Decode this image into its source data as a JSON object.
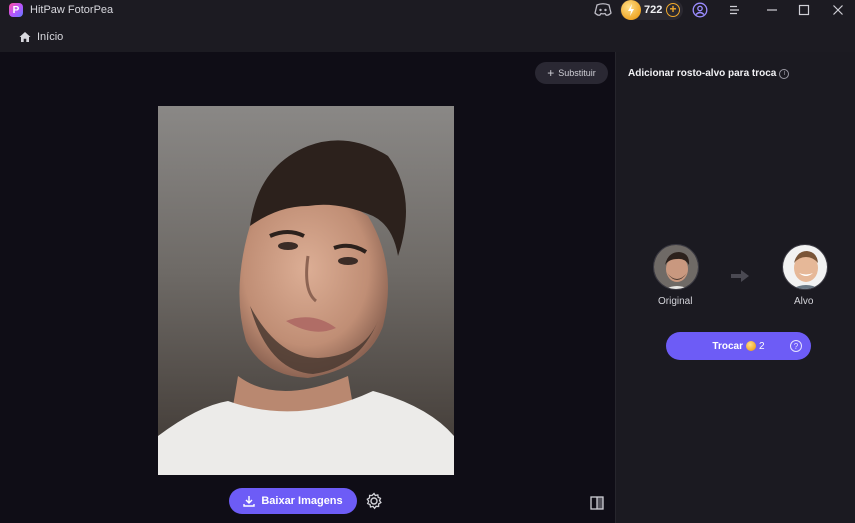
{
  "app": {
    "title": "HitPaw FotorPea",
    "logo_letter": "P",
    "coins": "722"
  },
  "nav": {
    "home_label": "Início"
  },
  "canvas": {
    "replace_label": "Substituir",
    "download_label": "Baixar Imagens"
  },
  "panel": {
    "title": "Adicionar rosto-alvo para troca",
    "info_icon": "i",
    "original_label": "Original",
    "target_label": "Alvo",
    "swap_label": "Trocar",
    "swap_cost": "2",
    "help_icon": "?"
  },
  "icons": {
    "titlebar": [
      "discord-icon",
      "coin-icon",
      "add-coins-icon",
      "user-icon",
      "menu-icon",
      "minimize-icon",
      "maximize-icon",
      "close-icon"
    ],
    "nav": [
      "home-icon"
    ],
    "canvas": [
      "plus-icon",
      "zoom-in-icon",
      "download-icon",
      "settings-icon",
      "compare-icon"
    ],
    "panel": [
      "info-icon",
      "arrow-right-icon",
      "coin-icon",
      "help-icon"
    ]
  },
  "colors": {
    "accent": "#6d5cf6",
    "coin": "#f0a82a",
    "panel_bg": "#1b1a21",
    "canvas_bg": "#0f0d16"
  }
}
